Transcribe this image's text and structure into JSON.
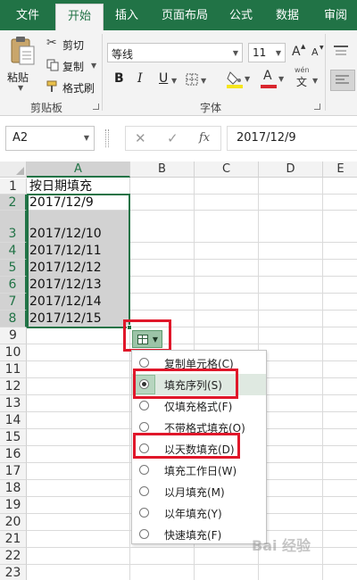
{
  "tabs": [
    "文件",
    "开始",
    "插入",
    "页面布局",
    "公式",
    "数据",
    "审阅"
  ],
  "active_tab": "开始",
  "clipboard": {
    "paste_label": "粘贴",
    "cut_label": "剪切",
    "copy_label": "复制",
    "format_painter_label": "格式刷",
    "group_label": "剪贴板"
  },
  "font": {
    "font_name": "等线",
    "font_size": "11",
    "grow_label": "A",
    "shrink_label": "A",
    "bold": "B",
    "italic": "I",
    "underline": "U",
    "font_color_label": "A",
    "phonetic_label": "wén",
    "group_label": "字体",
    "fill_color": "#f5e51c",
    "font_color": "#d9262e"
  },
  "formula_bar": {
    "name_box": "A2",
    "cancel_icon": "✕",
    "enter_icon": "✓",
    "fx_label": "fx",
    "formula": "2017/12/9"
  },
  "columns": [
    "A",
    "B",
    "C",
    "D",
    "E"
  ],
  "rows": [
    "1",
    "2",
    "3",
    "4",
    "5",
    "6",
    "7",
    "8",
    "9",
    "10",
    "11",
    "12",
    "13",
    "14",
    "15",
    "16",
    "17",
    "18",
    "19",
    "20",
    "21",
    "22",
    "23"
  ],
  "cells": [
    "按日期填充",
    "2017/12/9",
    "2017/12/10",
    "2017/12/11",
    "2017/12/12",
    "2017/12/13",
    "2017/12/14",
    "2017/12/15"
  ],
  "autofill_menu": [
    {
      "label": "复制单元格(C)",
      "selected": false
    },
    {
      "label": "填充序列(S)",
      "selected": true
    },
    {
      "label": "仅填充格式(F)",
      "selected": false
    },
    {
      "label": "不带格式填充(O)",
      "selected": false
    },
    {
      "label": "以天数填充(D)",
      "selected": false
    },
    {
      "label": "填充工作日(W)",
      "selected": false
    },
    {
      "label": "以月填充(M)",
      "selected": false
    },
    {
      "label": "以年填充(Y)",
      "selected": false
    },
    {
      "label": "快速填充(F)",
      "selected": false
    }
  ],
  "watermark": "Bai 经验",
  "colors": {
    "excel_green": "#217346",
    "highlight_red": "#e0172a",
    "selection_gray": "#d2d2d2"
  }
}
